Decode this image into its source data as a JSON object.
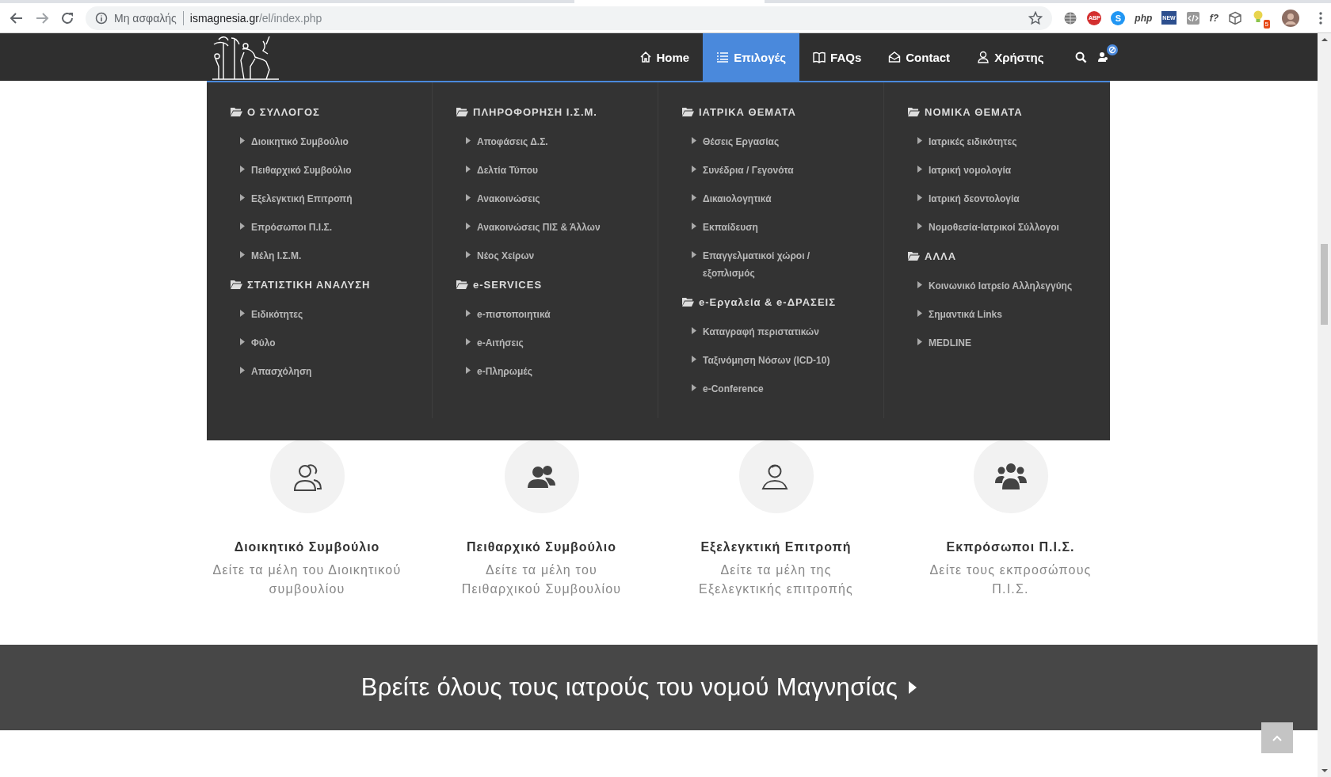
{
  "browser": {
    "security_label": "Μη ασφαλής",
    "url_host": "ismagnesia.gr",
    "url_path": "/el/index.php",
    "extensions": [
      {
        "kind": "globe"
      },
      {
        "kind": "stop",
        "text": "ABP"
      },
      {
        "kind": "skype",
        "text": "S"
      },
      {
        "kind": "plain",
        "text": "php"
      },
      {
        "kind": "tag",
        "text": "NEW"
      },
      {
        "kind": "code"
      },
      {
        "kind": "plain",
        "text": "f?"
      },
      {
        "kind": "cube"
      },
      {
        "kind": "bulb",
        "badge": "5"
      },
      {
        "kind": "avatar"
      }
    ]
  },
  "nav": {
    "items": [
      {
        "label": "Home",
        "kind": "home",
        "selected": false
      },
      {
        "label": "Επιλογές",
        "kind": "list",
        "selected": true
      },
      {
        "label": "FAQs",
        "kind": "book",
        "selected": false
      },
      {
        "label": "Contact",
        "kind": "envelope",
        "selected": false
      },
      {
        "label": "Χρήστης",
        "kind": "user",
        "selected": false
      }
    ]
  },
  "mega_menu": {
    "columns": [
      {
        "groups": [
          {
            "title": "Ο ΣΥΛΛΟΓΟΣ",
            "items": [
              "Διοικητικό Συμβούλιο",
              "Πειθαρχικό Συμβούλιο",
              "Εξελεγκτική Επιτροπή",
              "Επρόσωποι Π.Ι.Σ.",
              "Μέλη Ι.Σ.Μ."
            ]
          },
          {
            "title": "ΣΤΑΤΙΣΤΙΚΗ ΑΝΑΛΥΣΗ",
            "items": [
              "Ειδικότητες",
              "Φύλο",
              "Απασχόληση"
            ]
          }
        ]
      },
      {
        "groups": [
          {
            "title": "ΠΛΗΡΟΦΟΡΗΣΗ Ι.Σ.Μ.",
            "items": [
              "Αποφάσεις Δ.Σ.",
              "Δελτία Τύπου",
              "Ανακοινώσεις",
              "Ανακοινώσεις ΠΙΣ & Άλλων",
              "Νέος Χείρων"
            ]
          },
          {
            "title": "e-SERVICES",
            "items": [
              "e-πιστοποιητικά",
              "e-Αιτήσεις",
              "e-Πληρωμές"
            ]
          }
        ]
      },
      {
        "groups": [
          {
            "title": "ΙΑΤΡΙΚΑ ΘΕΜΑΤΑ",
            "items": [
              "Θέσεις Εργασίας",
              "Συνέδρια / Γεγονότα",
              "Δικαιολογητικά",
              "Εκπαίδευση",
              "Επαγγελματικοί χώροι / εξοπλισμός"
            ]
          },
          {
            "title": "e-Εργαλεία & e-ΔΡΑΣΕΙΣ",
            "items": [
              "Καταγραφή περιστατικών",
              "Ταξινόμηση Νόσων (ICD-10)",
              "e-Conference"
            ]
          }
        ]
      },
      {
        "groups": [
          {
            "title": "ΝΟΜΙΚΑ ΘΕΜΑΤΑ",
            "items": [
              "Ιατρικές ειδικότητες",
              "Ιατρική νομολογία",
              "Ιατρική δεοντολογία",
              "Νομοθεσία-Ιατρικοί Σύλλογοι"
            ]
          },
          {
            "title": "ΑΛΛΑ",
            "items": [
              "Κοινωνικό Ιατρείο Αλληλεγγύης",
              "Σημαντικά Links",
              "MEDLINE"
            ]
          }
        ]
      }
    ]
  },
  "cards": [
    {
      "kind": "users-outline",
      "title": "Διοικητικό Συμβούλιο",
      "text": "Δείτε τα μέλη του Διοικητικού συμβουλίου"
    },
    {
      "kind": "users-solid",
      "title": "Πειθαρχικό Συμβούλιο",
      "text": "Δείτε τα μέλη του Πειθαρχικού Συμβουλίου"
    },
    {
      "kind": "user-outline",
      "title": "Εξελεγκτική Επιτροπή",
      "text": "Δείτε τα μέλη της Εξελεγκτικής επιτροπής"
    },
    {
      "kind": "group-solid",
      "title": "Εκπρόσωποι Π.Ι.Σ.",
      "text": "Δείτε τους εκπροσώπους Π.Ι.Σ."
    }
  ],
  "banner": {
    "text": "Βρείτε όλους τους ιατρούς του νομού Μαγνησίας"
  }
}
